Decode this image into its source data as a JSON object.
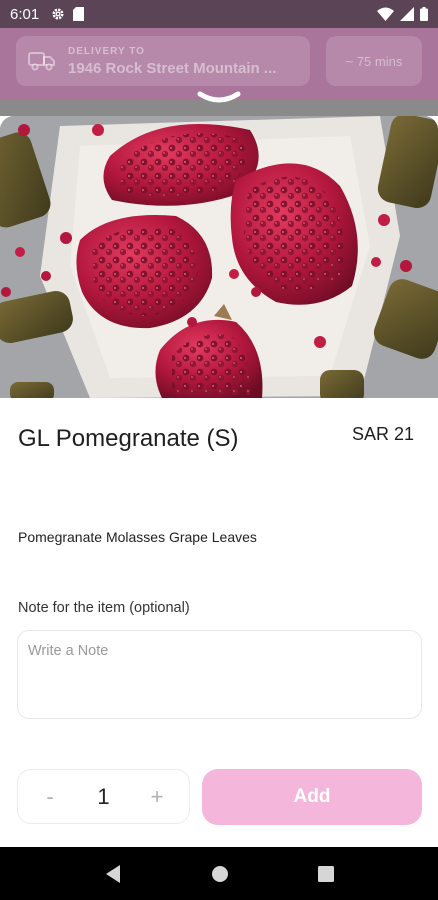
{
  "status_bar": {
    "time": "6:01",
    "icons": [
      "gear-icon",
      "sim-card-icon",
      "wifi-icon",
      "signal-icon",
      "battery-icon"
    ]
  },
  "header": {
    "delivery_label": "DELIVERY TO",
    "delivery_address": "1946 Rock Street Mountain ...",
    "eta": "~ 75 mins",
    "icons": [
      "delivery-truck-icon"
    ]
  },
  "product": {
    "image": "pomegranate-photo",
    "title": "GL Pomegranate (S)",
    "price": "SAR 21",
    "description": "Pomegranate Molasses Grape Leaves"
  },
  "note": {
    "label": "Note for the item (optional)",
    "placeholder": "Write a Note",
    "value": ""
  },
  "quantity": {
    "minus_label": "-",
    "value": "1",
    "plus_label": "+"
  },
  "add_button": {
    "label": "Add"
  },
  "nav_bar": {
    "icons": [
      "back-icon",
      "home-icon",
      "recents-icon"
    ]
  },
  "colors": {
    "accent": "#f5b6dc",
    "status_bar": "#5b4455",
    "header_dim": "#b57aa6"
  }
}
